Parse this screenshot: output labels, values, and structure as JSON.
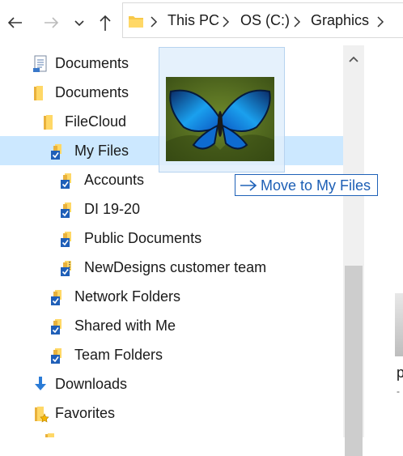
{
  "nav": {
    "back_icon": "back-arrow-icon",
    "forward_icon": "forward-arrow-icon",
    "recent_icon": "chevron-down-icon",
    "up_icon": "up-arrow-icon"
  },
  "address_bar": {
    "crumbs": [
      "This PC",
      "OS (C:)",
      "Graphics"
    ],
    "separator_icon": "chevron-right-icon"
  },
  "tree": {
    "items": [
      {
        "label": "Documents",
        "icon": "document-library-icon"
      },
      {
        "label": "Documents",
        "icon": "folder-icon"
      },
      {
        "label": "FileCloud",
        "icon": "folder-icon"
      },
      {
        "label": "My Files",
        "icon": "synced-folder-icon",
        "selected": true
      },
      {
        "label": "Accounts",
        "icon": "synced-folder-icon"
      },
      {
        "label": "DI 19-20",
        "icon": "synced-folder-icon"
      },
      {
        "label": "Public Documents",
        "icon": "synced-folder-icon"
      },
      {
        "label": "NewDesigns customer team",
        "icon": "synced-zip-folder-icon"
      },
      {
        "label": "Network Folders",
        "icon": "synced-folder-icon"
      },
      {
        "label": "Shared with Me",
        "icon": "synced-folder-icon"
      },
      {
        "label": "Team Folders",
        "icon": "synced-folder-icon"
      },
      {
        "label": "Downloads",
        "icon": "download-icon"
      },
      {
        "label": "Favorites",
        "icon": "favorites-folder-icon"
      }
    ]
  },
  "drag": {
    "image_subject": "blue butterfly photo",
    "tooltip": "Move to My Files"
  },
  "right_pane": {
    "partial_text": "p",
    "partial_sub": "-"
  },
  "colors": {
    "selection": "#cce8ff",
    "tooltip_text": "#1d5fb5",
    "folder_yellow": "#f8c94a",
    "check_blue": "#1f5fb8"
  }
}
